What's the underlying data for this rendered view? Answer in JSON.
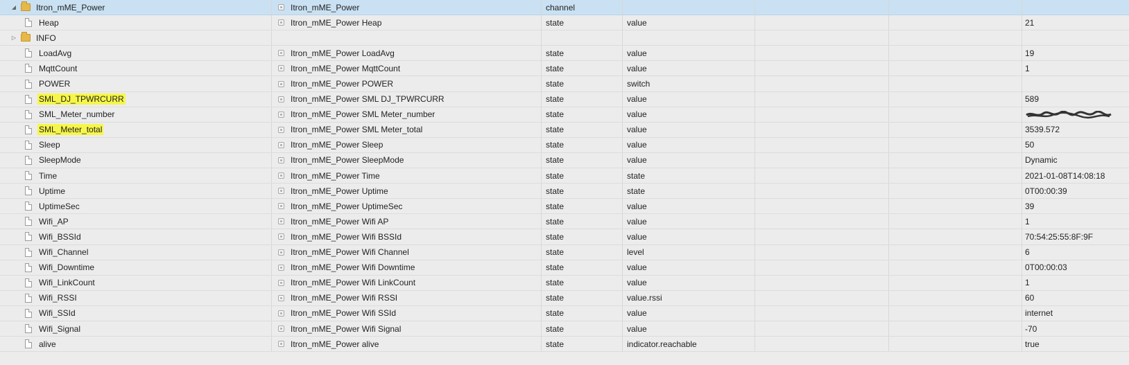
{
  "colors": {
    "selected_row": "#c9e1f2",
    "highlight": "#f6f64a",
    "folder": "#e6b84a",
    "background": "#ececec"
  },
  "rows": [
    {
      "name": "Itron_mME_Power",
      "kind": "folder",
      "expander": "expanded",
      "title": "Itron_mME_Power",
      "type": "channel",
      "role": "",
      "value": "",
      "selected": true,
      "highlighted": false
    },
    {
      "name": "Heap",
      "kind": "state",
      "expander": "",
      "title": "Itron_mME_Power Heap",
      "type": "state",
      "role": "value",
      "value": "21",
      "selected": false,
      "highlighted": false
    },
    {
      "name": "INFO",
      "kind": "folder",
      "expander": "collapsed",
      "title": "",
      "type": "",
      "role": "",
      "value": "",
      "selected": false,
      "highlighted": false
    },
    {
      "name": "LoadAvg",
      "kind": "state",
      "expander": "",
      "title": "Itron_mME_Power LoadAvg",
      "type": "state",
      "role": "value",
      "value": "19",
      "selected": false,
      "highlighted": false
    },
    {
      "name": "MqttCount",
      "kind": "state",
      "expander": "",
      "title": "Itron_mME_Power MqttCount",
      "type": "state",
      "role": "value",
      "value": "1",
      "selected": false,
      "highlighted": false
    },
    {
      "name": "POWER",
      "kind": "state",
      "expander": "",
      "title": "Itron_mME_Power POWER",
      "type": "state",
      "role": "switch",
      "value": "",
      "selected": false,
      "highlighted": false
    },
    {
      "name": "SML_DJ_TPWRCURR",
      "kind": "state",
      "expander": "",
      "title": "Itron_mME_Power SML DJ_TPWRCURR",
      "type": "state",
      "role": "value",
      "value": "589",
      "selected": false,
      "highlighted": true
    },
    {
      "name": "SML_Meter_number",
      "kind": "state",
      "expander": "",
      "title": "Itron_mME_Power SML Meter_number",
      "type": "state",
      "role": "value",
      "value": "",
      "redacted": true,
      "selected": false,
      "highlighted": false
    },
    {
      "name": "SML_Meter_total",
      "kind": "state",
      "expander": "",
      "title": "Itron_mME_Power SML Meter_total",
      "type": "state",
      "role": "value",
      "value": "3539.572",
      "selected": false,
      "highlighted": true
    },
    {
      "name": "Sleep",
      "kind": "state",
      "expander": "",
      "title": "Itron_mME_Power Sleep",
      "type": "state",
      "role": "value",
      "value": "50",
      "selected": false,
      "highlighted": false
    },
    {
      "name": "SleepMode",
      "kind": "state",
      "expander": "",
      "title": "Itron_mME_Power SleepMode",
      "type": "state",
      "role": "value",
      "value": "Dynamic",
      "selected": false,
      "highlighted": false
    },
    {
      "name": "Time",
      "kind": "state",
      "expander": "",
      "title": "Itron_mME_Power Time",
      "type": "state",
      "role": "state",
      "value": "2021-01-08T14:08:18",
      "selected": false,
      "highlighted": false
    },
    {
      "name": "Uptime",
      "kind": "state",
      "expander": "",
      "title": "Itron_mME_Power Uptime",
      "type": "state",
      "role": "state",
      "value": "0T00:00:39",
      "selected": false,
      "highlighted": false
    },
    {
      "name": "UptimeSec",
      "kind": "state",
      "expander": "",
      "title": "Itron_mME_Power UptimeSec",
      "type": "state",
      "role": "value",
      "value": "39",
      "selected": false,
      "highlighted": false
    },
    {
      "name": "Wifi_AP",
      "kind": "state",
      "expander": "",
      "title": "Itron_mME_Power Wifi AP",
      "type": "state",
      "role": "value",
      "value": "1",
      "selected": false,
      "highlighted": false
    },
    {
      "name": "Wifi_BSSId",
      "kind": "state",
      "expander": "",
      "title": "Itron_mME_Power Wifi BSSId",
      "type": "state",
      "role": "value",
      "value": "70:54:25:55:8F:9F",
      "selected": false,
      "highlighted": false
    },
    {
      "name": "Wifi_Channel",
      "kind": "state",
      "expander": "",
      "title": "Itron_mME_Power Wifi Channel",
      "type": "state",
      "role": "level",
      "value": "6",
      "selected": false,
      "highlighted": false
    },
    {
      "name": "Wifi_Downtime",
      "kind": "state",
      "expander": "",
      "title": "Itron_mME_Power Wifi Downtime",
      "type": "state",
      "role": "value",
      "value": "0T00:00:03",
      "selected": false,
      "highlighted": false
    },
    {
      "name": "Wifi_LinkCount",
      "kind": "state",
      "expander": "",
      "title": "Itron_mME_Power Wifi LinkCount",
      "type": "state",
      "role": "value",
      "value": "1",
      "selected": false,
      "highlighted": false
    },
    {
      "name": "Wifi_RSSI",
      "kind": "state",
      "expander": "",
      "title": "Itron_mME_Power Wifi RSSI",
      "type": "state",
      "role": "value.rssi",
      "value": "60",
      "selected": false,
      "highlighted": false
    },
    {
      "name": "Wifi_SSId",
      "kind": "state",
      "expander": "",
      "title": "Itron_mME_Power Wifi SSId",
      "type": "state",
      "role": "value",
      "value": "internet",
      "selected": false,
      "highlighted": false
    },
    {
      "name": "Wifi_Signal",
      "kind": "state",
      "expander": "",
      "title": "Itron_mME_Power Wifi Signal",
      "type": "state",
      "role": "value",
      "value": "-70",
      "selected": false,
      "highlighted": false
    },
    {
      "name": "alive",
      "kind": "state",
      "expander": "",
      "title": "Itron_mME_Power alive",
      "type": "state",
      "role": "indicator.reachable",
      "value": "true",
      "selected": false,
      "highlighted": false
    }
  ]
}
